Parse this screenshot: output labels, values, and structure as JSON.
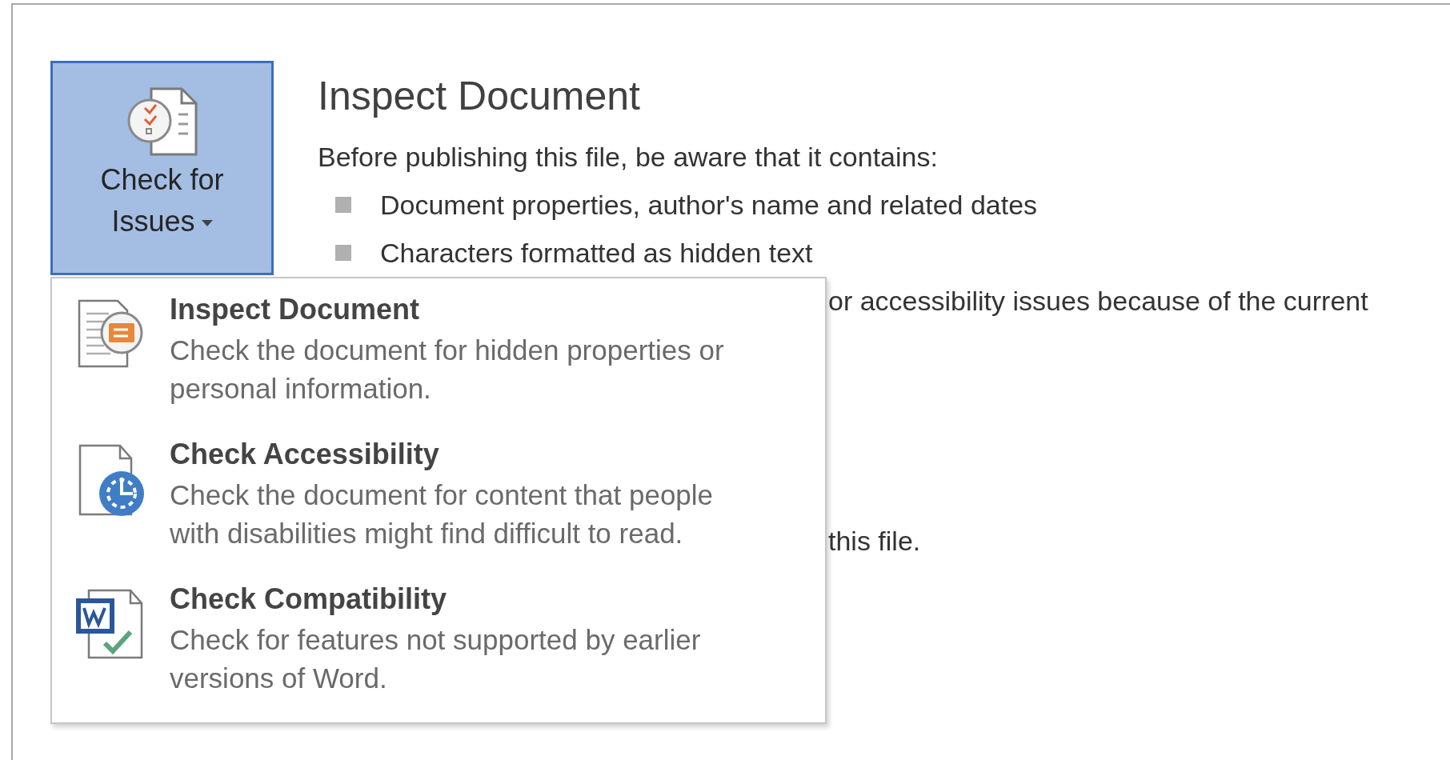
{
  "button": {
    "label": "Check for Issues",
    "active": true
  },
  "panel": {
    "title": "Inspect Document",
    "intro": "Before publishing this file, be aware that it contains:",
    "items": [
      "Document properties, author's name and related dates",
      "Characters formatted as hidden text"
    ],
    "partial_lines": [
      "or accessibility issues because of the current",
      "this file."
    ]
  },
  "menu": {
    "items": [
      {
        "kind": "inspect",
        "title": "Inspect Document",
        "description": "Check the document for hidden properties or personal information."
      },
      {
        "kind": "accessibility",
        "title": "Check Accessibility",
        "description": "Check the document for content that people with disabilities might find difficult to read."
      },
      {
        "kind": "compatibility",
        "title": "Check Compatibility",
        "description": "Check for features not supported by earlier versions of Word."
      }
    ]
  }
}
